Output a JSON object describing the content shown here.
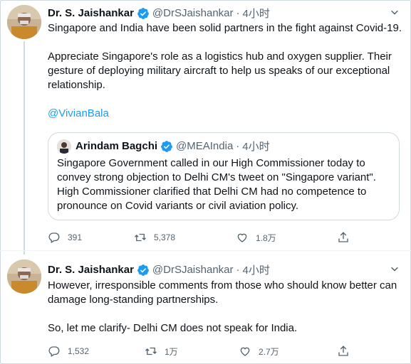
{
  "colors": {
    "accent": "#1d9bf0",
    "text": "#0f1419",
    "muted": "#536471",
    "border": "#cfd9de"
  },
  "tweet1": {
    "author": "Dr. S. Jaishankar",
    "handle": "@DrSJaishankar",
    "separator": "·",
    "time": "4小时",
    "para1": "Singapore and India have been solid partners in the fight against Covid-19.",
    "para2": "Appreciate Singapore's role as a logistics hub and oxygen supplier. Their gesture of deploying military aircraft to help us speaks of our exceptional relationship.",
    "mention": "@VivianBala",
    "quote": {
      "author": "Arindam Bagchi",
      "handle": "@MEAIndia",
      "separator": "·",
      "time": "4小时",
      "text": "Singapore Government called in our High Commissioner today to convey strong objection to Delhi CM's tweet on \"Singapore variant\". High Commissioner clarified that Delhi CM had no competence to pronounce on Covid variants or civil aviation policy."
    },
    "actions": {
      "replies": "391",
      "retweets": "5,378",
      "likes": "1.8万"
    }
  },
  "tweet2": {
    "author": "Dr. S. Jaishankar",
    "handle": "@DrSJaishankar",
    "separator": "·",
    "time": "4小时",
    "para1": "However, irresponsible comments from those who should know better can damage long-standing partnerships.",
    "para2": "So, let me clarify- Delhi CM does not speak for India.",
    "actions": {
      "replies": "1,532",
      "retweets": "1万",
      "likes": "2.7万"
    }
  },
  "icons": [
    "verified-badge-icon",
    "chevron-down-icon",
    "reply-icon",
    "retweet-icon",
    "like-icon",
    "share-icon"
  ]
}
